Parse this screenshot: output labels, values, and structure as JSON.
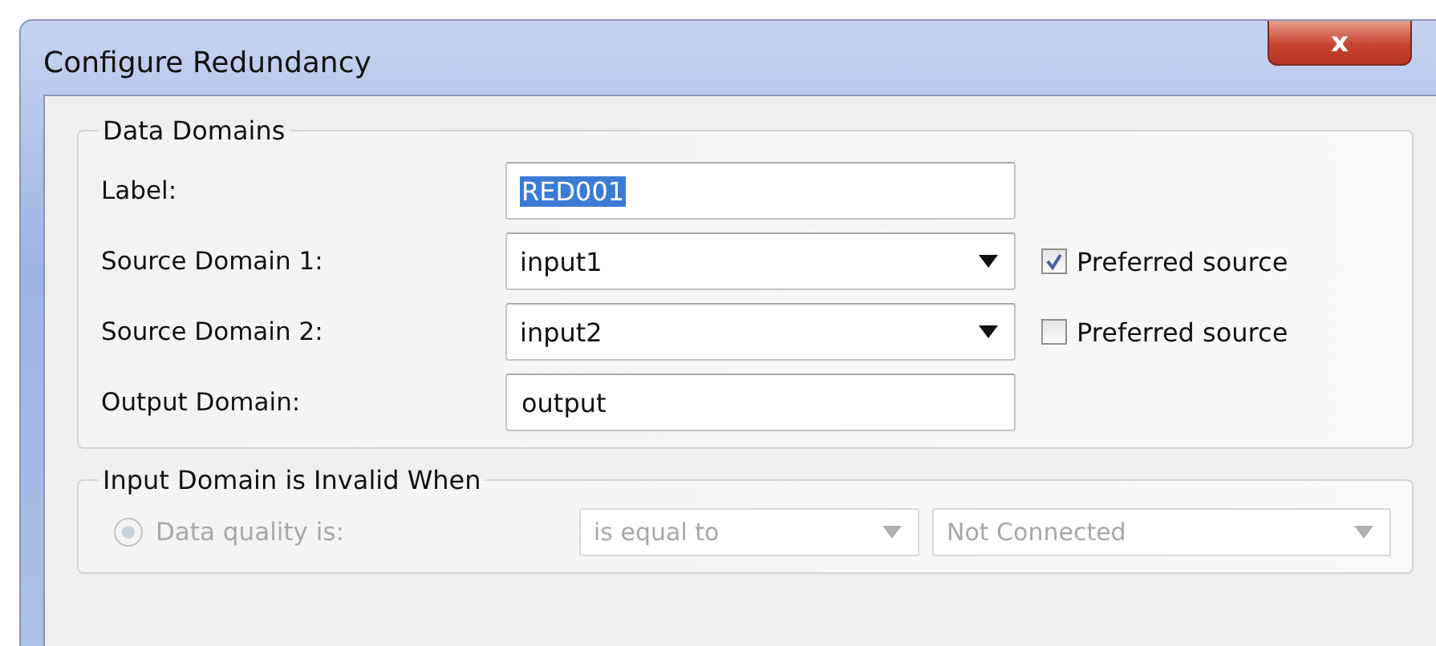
{
  "window": {
    "title": "Configure Redundancy",
    "close_label": "x"
  },
  "data_domains": {
    "title": "Data Domains",
    "rows": [
      {
        "kind": "text",
        "label": "Label:",
        "value": "RED001",
        "highlighted": true
      },
      {
        "kind": "select",
        "label": "Source Domain 1:",
        "value": "input1",
        "checkbox": {
          "label": "Preferred source",
          "checked": true
        }
      },
      {
        "kind": "select",
        "label": "Source Domain 2:",
        "value": "input2",
        "checkbox": {
          "label": "Preferred source",
          "checked": false
        }
      },
      {
        "kind": "text",
        "label": "Output Domain:",
        "value": "output",
        "highlighted": false
      }
    ]
  },
  "invalid_when": {
    "title": "Input Domain is Invalid When",
    "rows": [
      {
        "label": "Data quality is:",
        "selected": true,
        "disabled": true,
        "operator": "is equal to",
        "value": "Not Connected"
      }
    ]
  }
}
